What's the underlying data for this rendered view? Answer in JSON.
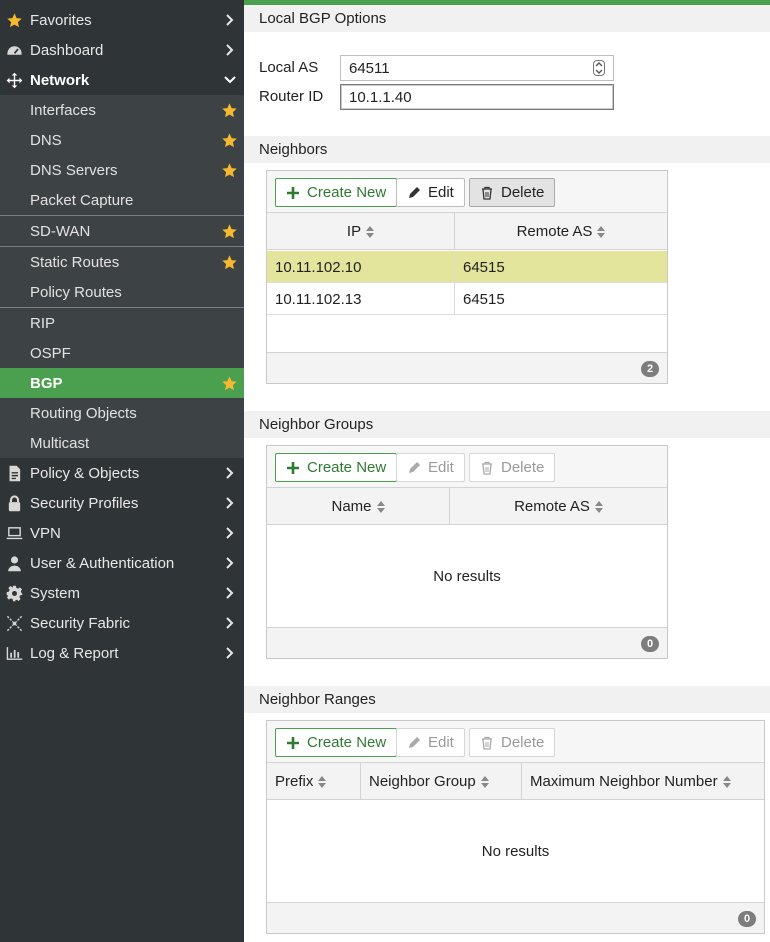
{
  "sidebar": {
    "top_items": [
      {
        "label": "Favorites",
        "icon": "star-icon"
      },
      {
        "label": "Dashboard",
        "icon": "gauge-icon"
      },
      {
        "label": "Network",
        "icon": "network-move-icon"
      },
      {
        "label": "Policy & Objects",
        "icon": "document-icon"
      },
      {
        "label": "Security Profiles",
        "icon": "lock-icon"
      },
      {
        "label": "VPN",
        "icon": "laptop-icon"
      },
      {
        "label": "User & Authentication",
        "icon": "user-icon"
      },
      {
        "label": "System",
        "icon": "gear-icon"
      },
      {
        "label": "Security Fabric",
        "icon": "fabric-icon"
      },
      {
        "label": "Log & Report",
        "icon": "bar-chart-icon"
      }
    ],
    "network_items": [
      {
        "label": "Interfaces",
        "starred": true
      },
      {
        "label": "DNS",
        "starred": true
      },
      {
        "label": "DNS Servers",
        "starred": true
      },
      {
        "label": "Packet Capture",
        "starred": false
      },
      {
        "label": "SD-WAN",
        "starred": true
      },
      {
        "label": "Static Routes",
        "starred": true
      },
      {
        "label": "Policy Routes",
        "starred": false
      },
      {
        "label": "RIP",
        "starred": false
      },
      {
        "label": "OSPF",
        "starred": false
      },
      {
        "label": "BGP",
        "starred": true,
        "active": true
      },
      {
        "label": "Routing Objects",
        "starred": false
      },
      {
        "label": "Multicast",
        "starred": false
      }
    ]
  },
  "local_bgp": {
    "title": "Local BGP Options",
    "local_as_label": "Local AS",
    "local_as_value": "64511",
    "router_id_label": "Router ID",
    "router_id_value": "10.1.1.40"
  },
  "buttons": {
    "create": "Create New",
    "edit": "Edit",
    "delete": "Delete"
  },
  "neighbors": {
    "title": "Neighbors",
    "columns": [
      "IP",
      "Remote AS"
    ],
    "rows": [
      {
        "ip": "10.11.102.10",
        "remote_as": "64515"
      },
      {
        "ip": "10.11.102.13",
        "remote_as": "64515"
      }
    ],
    "count": "2"
  },
  "neighbor_groups": {
    "title": "Neighbor Groups",
    "columns": [
      "Name",
      "Remote AS"
    ],
    "empty_text": "No results",
    "count": "0"
  },
  "neighbor_ranges": {
    "title": "Neighbor Ranges",
    "columns": [
      "Prefix",
      "Neighbor Group",
      "Maximum Neighbor Number"
    ],
    "empty_text": "No results",
    "count": "0"
  },
  "colors": {
    "sidebar_bg": "#2f3436",
    "accent_green": "#4aa04e",
    "star_yellow": "#f5b82e",
    "selected_row": "#e4e59c"
  }
}
